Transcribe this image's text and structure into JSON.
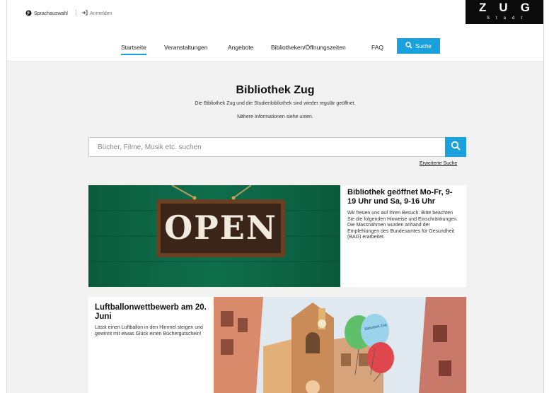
{
  "topbar": {
    "language_label": "Sprachauswahl",
    "login_label": "Anmelden"
  },
  "brand": {
    "name": "ZUG",
    "sub": "Stadt"
  },
  "nav": {
    "items": [
      {
        "label": "Startseite",
        "active": true
      },
      {
        "label": "Veranstaltungen",
        "active": false
      },
      {
        "label": "Angebote",
        "active": false
      },
      {
        "label": "Bibliotheken/Öffnungszeiten",
        "active": false
      },
      {
        "label": "FAQ",
        "active": false
      }
    ],
    "search_label": "Suche"
  },
  "hero": {
    "title": "Bibliothek Zug",
    "line1": "Die Bibliothek Zug und die Studienbibliothek sind wieder regulär geöffnet.",
    "line2": "Nähere Informationen siehe unten."
  },
  "search": {
    "placeholder": "Bücher, Filme, Musik etc. suchen",
    "value": "",
    "advanced_label": "Erweiterte Suche"
  },
  "cards": [
    {
      "title": "Bibliothek geöffnet Mo-Fr, 9-19 Uhr und Sa, 9-16 Uhr",
      "text": "Wir freuen uns auf Ihren Besuch. Bitte beachten Sie die folgenden Hinweise und Einschränkungen. Die Massnahmen wurden anhand der Empfehlungen des Bundesamtes für Gesundheit (BAG) erarbeitet.",
      "sign_text": "OPEN"
    },
    {
      "title": "Luftballonwettbewerb am 20. Juni",
      "text": "Lasst einen Luftballon in den Himmel steigen und gewinnt mit etwas Glück einen Büchergutschein!",
      "balloon_text": "Bibliothek Zug"
    }
  ],
  "colors": {
    "accent": "#1aa0db",
    "brand_bg": "#0b0b0b",
    "page_bg": "#f2f2f2",
    "green_wall": "#0f6b4b"
  },
  "icons": [
    "globe-icon",
    "login-icon",
    "search-icon"
  ]
}
